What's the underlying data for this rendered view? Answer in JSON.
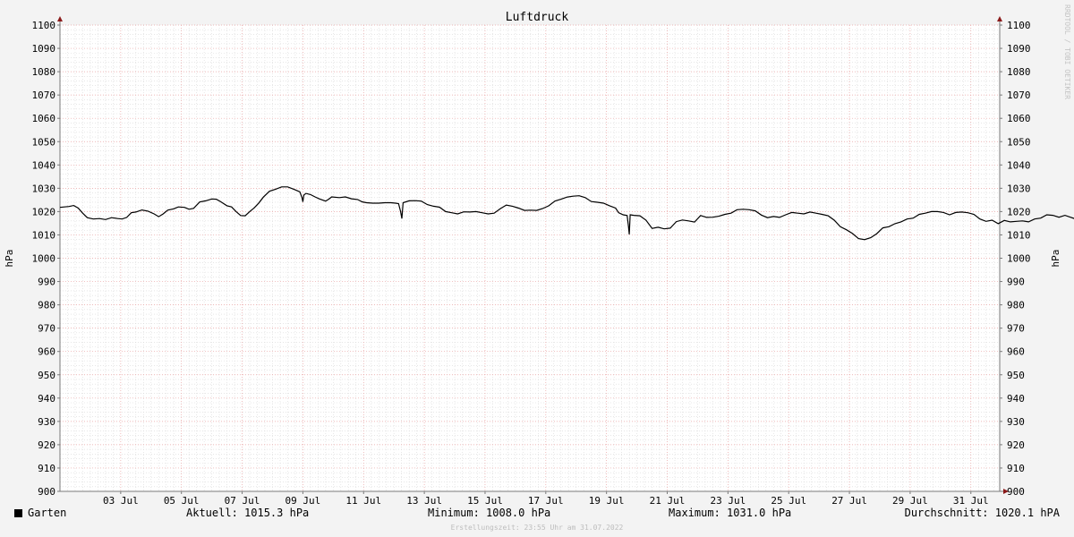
{
  "chart_data": {
    "type": "line",
    "title": "Luftdruck",
    "ylabel": "hPa",
    "ylabel_right": "hPa",
    "xlabel": "",
    "ylim": [
      900,
      1100
    ],
    "yticks": [
      900,
      910,
      920,
      930,
      940,
      950,
      960,
      970,
      980,
      990,
      1000,
      1010,
      1020,
      1030,
      1040,
      1050,
      1060,
      1070,
      1080,
      1090,
      1100
    ],
    "xlim": [
      1,
      31.95
    ],
    "xticks": [
      {
        "day": 3,
        "label": "03 Jul"
      },
      {
        "day": 5,
        "label": "05 Jul"
      },
      {
        "day": 7,
        "label": "07 Jul"
      },
      {
        "day": 9,
        "label": "09 Jul"
      },
      {
        "day": 11,
        "label": "11 Jul"
      },
      {
        "day": 13,
        "label": "13 Jul"
      },
      {
        "day": 15,
        "label": "15 Jul"
      },
      {
        "day": 17,
        "label": "17 Jul"
      },
      {
        "day": 19,
        "label": "19 Jul"
      },
      {
        "day": 21,
        "label": "21 Jul"
      },
      {
        "day": 23,
        "label": "23 Jul"
      },
      {
        "day": 25,
        "label": "25 Jul"
      },
      {
        "day": 27,
        "label": "27 Jul"
      },
      {
        "day": 29,
        "label": "29 Jul"
      },
      {
        "day": 31,
        "label": "31 Jul"
      }
    ],
    "grid": true,
    "series": [
      {
        "name": "Garten",
        "color": "#000000",
        "points": [
          [
            1.0,
            1021.8
          ],
          [
            1.3,
            1022.2
          ],
          [
            1.45,
            1022.6
          ],
          [
            1.6,
            1021.5
          ],
          [
            1.75,
            1019.3
          ],
          [
            1.9,
            1017.4
          ],
          [
            2.1,
            1016.8
          ],
          [
            2.3,
            1017.0
          ],
          [
            2.5,
            1016.6
          ],
          [
            2.7,
            1017.4
          ],
          [
            2.9,
            1017.0
          ],
          [
            3.05,
            1016.8
          ],
          [
            3.2,
            1017.5
          ],
          [
            3.35,
            1019.5
          ],
          [
            3.5,
            1019.8
          ],
          [
            3.7,
            1020.7
          ],
          [
            3.9,
            1020.2
          ],
          [
            4.1,
            1019.0
          ],
          [
            4.25,
            1017.8
          ],
          [
            4.4,
            1019.0
          ],
          [
            4.55,
            1020.6
          ],
          [
            4.75,
            1021.2
          ],
          [
            4.9,
            1022.0
          ],
          [
            5.1,
            1021.8
          ],
          [
            5.25,
            1021.0
          ],
          [
            5.4,
            1021.4
          ],
          [
            5.6,
            1024.1
          ],
          [
            5.8,
            1024.6
          ],
          [
            6.0,
            1025.4
          ],
          [
            6.15,
            1025.3
          ],
          [
            6.3,
            1024.2
          ],
          [
            6.5,
            1022.5
          ],
          [
            6.65,
            1022.0
          ],
          [
            6.8,
            1020.0
          ],
          [
            6.95,
            1018.3
          ],
          [
            7.1,
            1018.2
          ],
          [
            7.25,
            1020.0
          ],
          [
            7.4,
            1021.6
          ],
          [
            7.55,
            1023.7
          ],
          [
            7.7,
            1026.2
          ],
          [
            7.9,
            1028.7
          ],
          [
            8.1,
            1029.6
          ],
          [
            8.3,
            1030.6
          ],
          [
            8.5,
            1030.6
          ],
          [
            8.7,
            1029.6
          ],
          [
            8.9,
            1028.5
          ],
          [
            8.97,
            1026.0
          ],
          [
            9.0,
            1024.2
          ],
          [
            9.03,
            1027.0
          ],
          [
            9.1,
            1027.8
          ],
          [
            9.25,
            1027.3
          ],
          [
            9.4,
            1026.3
          ],
          [
            9.55,
            1025.4
          ],
          [
            9.75,
            1024.5
          ],
          [
            9.85,
            1025.3
          ],
          [
            9.95,
            1026.3
          ],
          [
            10.2,
            1026.0
          ],
          [
            10.4,
            1026.3
          ],
          [
            10.6,
            1025.5
          ],
          [
            10.8,
            1025.2
          ],
          [
            10.95,
            1024.2
          ],
          [
            11.1,
            1023.8
          ],
          [
            11.3,
            1023.6
          ],
          [
            11.5,
            1023.6
          ],
          [
            11.7,
            1023.8
          ],
          [
            11.9,
            1023.8
          ],
          [
            12.05,
            1023.6
          ],
          [
            12.15,
            1023.4
          ],
          [
            12.22,
            1020.0
          ],
          [
            12.26,
            1017.0
          ],
          [
            12.3,
            1023.8
          ],
          [
            12.5,
            1024.6
          ],
          [
            12.7,
            1024.7
          ],
          [
            12.9,
            1024.5
          ],
          [
            13.1,
            1023.0
          ],
          [
            13.3,
            1022.3
          ],
          [
            13.5,
            1021.9
          ],
          [
            13.7,
            1020.0
          ],
          [
            13.9,
            1019.5
          ],
          [
            14.1,
            1019.0
          ],
          [
            14.3,
            1019.9
          ],
          [
            14.5,
            1019.8
          ],
          [
            14.7,
            1020.0
          ],
          [
            14.9,
            1019.5
          ],
          [
            15.1,
            1019.0
          ],
          [
            15.3,
            1019.3
          ],
          [
            15.5,
            1021.2
          ],
          [
            15.7,
            1022.8
          ],
          [
            15.9,
            1022.3
          ],
          [
            16.1,
            1021.5
          ],
          [
            16.3,
            1020.5
          ],
          [
            16.5,
            1020.6
          ],
          [
            16.7,
            1020.5
          ],
          [
            16.9,
            1021.3
          ],
          [
            17.1,
            1022.5
          ],
          [
            17.3,
            1024.5
          ],
          [
            17.5,
            1025.3
          ],
          [
            17.7,
            1026.2
          ],
          [
            17.9,
            1026.6
          ],
          [
            18.1,
            1026.8
          ],
          [
            18.3,
            1026.0
          ],
          [
            18.5,
            1024.3
          ],
          [
            18.7,
            1024.0
          ],
          [
            18.9,
            1023.6
          ],
          [
            19.1,
            1022.5
          ],
          [
            19.3,
            1021.5
          ],
          [
            19.4,
            1019.5
          ],
          [
            19.55,
            1018.6
          ],
          [
            19.68,
            1018.3
          ],
          [
            19.72,
            1014.0
          ],
          [
            19.75,
            1010.2
          ],
          [
            19.78,
            1018.6
          ],
          [
            19.9,
            1018.4
          ],
          [
            20.1,
            1018.2
          ],
          [
            20.3,
            1016.3
          ],
          [
            20.5,
            1012.8
          ],
          [
            20.7,
            1013.3
          ],
          [
            20.9,
            1012.6
          ],
          [
            21.1,
            1012.9
          ],
          [
            21.3,
            1015.7
          ],
          [
            21.5,
            1016.4
          ],
          [
            21.7,
            1016.0
          ],
          [
            21.9,
            1015.5
          ],
          [
            22.1,
            1018.3
          ],
          [
            22.3,
            1017.5
          ],
          [
            22.5,
            1017.6
          ],
          [
            22.7,
            1018.0
          ],
          [
            22.9,
            1018.8
          ],
          [
            23.1,
            1019.3
          ],
          [
            23.3,
            1020.8
          ],
          [
            23.5,
            1021.0
          ],
          [
            23.7,
            1020.8
          ],
          [
            23.9,
            1020.3
          ],
          [
            24.1,
            1018.5
          ],
          [
            24.3,
            1017.4
          ],
          [
            24.5,
            1017.9
          ],
          [
            24.7,
            1017.5
          ],
          [
            24.9,
            1018.6
          ],
          [
            25.1,
            1019.6
          ],
          [
            25.3,
            1019.3
          ],
          [
            25.5,
            1019.0
          ],
          [
            25.7,
            1019.8
          ],
          [
            25.9,
            1019.3
          ],
          [
            26.1,
            1018.8
          ],
          [
            26.3,
            1018.2
          ],
          [
            26.5,
            1016.3
          ],
          [
            26.7,
            1013.5
          ],
          [
            26.9,
            1012.2
          ],
          [
            27.1,
            1010.6
          ],
          [
            27.3,
            1008.4
          ],
          [
            27.5,
            1008.0
          ],
          [
            27.7,
            1008.8
          ],
          [
            27.9,
            1010.5
          ],
          [
            28.1,
            1013.0
          ],
          [
            28.3,
            1013.5
          ],
          [
            28.5,
            1014.8
          ],
          [
            28.7,
            1015.6
          ],
          [
            28.9,
            1016.8
          ],
          [
            29.1,
            1017.2
          ],
          [
            29.3,
            1018.8
          ],
          [
            29.5,
            1019.3
          ],
          [
            29.7,
            1020.0
          ],
          [
            29.9,
            1020.0
          ],
          [
            30.1,
            1019.6
          ],
          [
            30.3,
            1018.6
          ],
          [
            30.5,
            1019.6
          ],
          [
            30.7,
            1019.8
          ],
          [
            30.9,
            1019.5
          ],
          [
            31.1,
            1018.8
          ],
          [
            31.3,
            1016.8
          ],
          [
            31.5,
            1015.8
          ],
          [
            31.7,
            1016.3
          ],
          [
            31.9,
            1014.8
          ],
          [
            32.1,
            1016.2
          ],
          [
            32.3,
            1015.6
          ],
          [
            32.5,
            1015.8
          ],
          [
            32.7,
            1016.0
          ],
          [
            32.9,
            1015.6
          ],
          [
            33.1,
            1016.8
          ],
          [
            33.3,
            1017.2
          ],
          [
            33.5,
            1018.6
          ],
          [
            33.7,
            1018.4
          ],
          [
            33.9,
            1017.6
          ],
          [
            34.1,
            1018.4
          ],
          [
            34.3,
            1017.5
          ],
          [
            34.5,
            1016.6
          ],
          [
            34.7,
            1016.0
          ],
          [
            34.9,
            1015.5
          ],
          [
            35.1,
            1014.2
          ],
          [
            35.3,
            1014.0
          ],
          [
            35.5,
            1015.3
          ]
        ]
      }
    ]
  },
  "legend": {
    "series_name": "Garten",
    "aktuell": "Aktuell: 1015.3 hPa",
    "minimum": "Minimum: 1008.0 hPa",
    "maximum": "Maximum: 1031.0 hPa",
    "durchschnitt": "Durchschnitt: 1020.1 hPA"
  },
  "footer": "Erstellungszeit: 23:55 Uhr am 31.07.2022",
  "watermark": "RRDTOOL / TOBI OETIKER",
  "colors": {
    "background": "#f3f3f3",
    "plot_area": "#ffffff",
    "minor_grid": "#d8d8d8",
    "major_grid": "#e8a0a0",
    "axis": "#7a7a7a",
    "arrow": "#8b1a1a",
    "line": "#000000"
  }
}
